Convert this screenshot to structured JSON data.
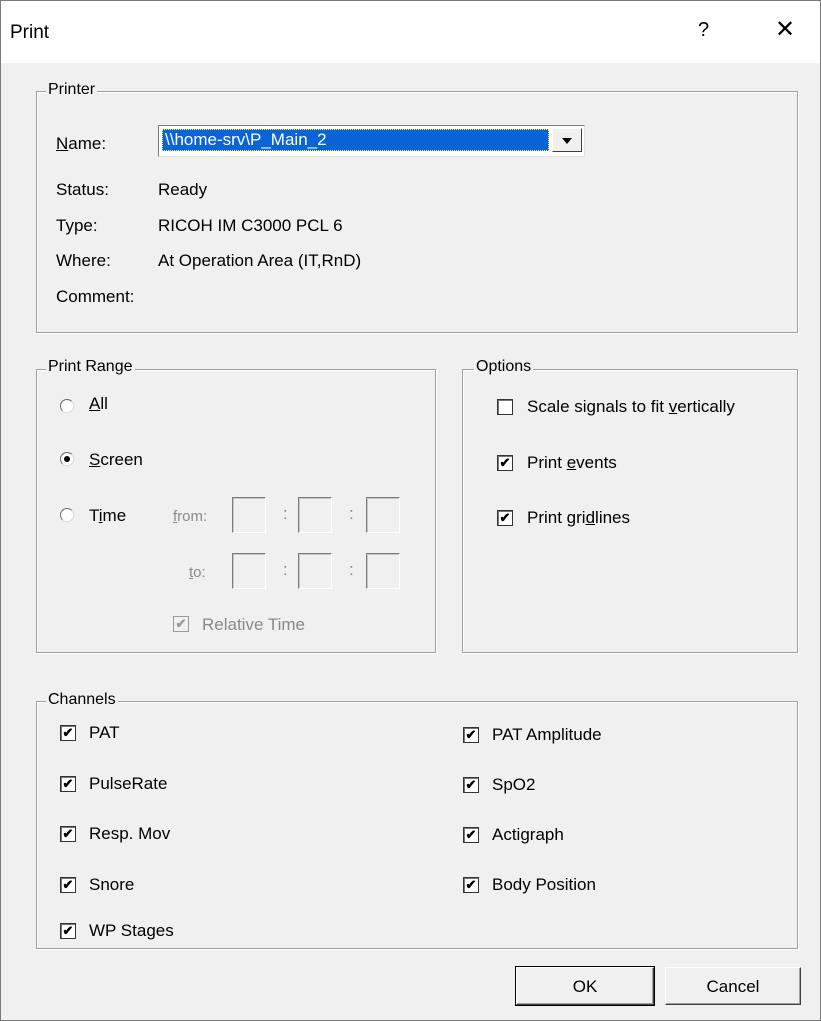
{
  "window": {
    "title": "Print",
    "help_label": "?",
    "close_label": "✕"
  },
  "printer": {
    "group_label": "Printer",
    "name_label": "ame:",
    "name_mnemonic": "N",
    "name_value": "\\\\home-srv\\P_Main_2",
    "status_label": "Status:",
    "status_value": "Ready",
    "type_label": "Type:",
    "type_value": "RICOH IM C3000 PCL 6",
    "where_label": "Where:",
    "where_value": "At Operation Area (IT,RnD)",
    "comment_label": "Comment:",
    "comment_value": ""
  },
  "print_range": {
    "group_label": "Print Range",
    "all": {
      "mnemonic": "A",
      "rest": "ll",
      "selected": false
    },
    "screen": {
      "mnemonic": "S",
      "rest": "creen",
      "selected": true
    },
    "time": {
      "pre": "T",
      "mnemonic": "i",
      "rest": "me",
      "selected": false
    },
    "from_mnemonic": "f",
    "from_rest": "rom:",
    "to_mnemonic": "t",
    "to_rest": "o:",
    "separator": ":",
    "relative_time_label": "Relative Time",
    "relative_time_checked": true,
    "relative_time_check": "✔"
  },
  "options": {
    "group_label": "Options",
    "scale": {
      "pre": "Scale signals to fit ",
      "mnemonic": "v",
      "rest": "ertically",
      "checked": false,
      "mark": ""
    },
    "events": {
      "pre": "Print ",
      "mnemonic": "e",
      "rest": "vents",
      "checked": true,
      "mark": "✔"
    },
    "gridlines": {
      "pre": "Print gri",
      "mnemonic": "d",
      "rest": "lines",
      "checked": true,
      "mark": "✔"
    }
  },
  "channels": {
    "group_label": "Channels",
    "left": [
      {
        "label": "PAT",
        "checked": true,
        "mark": "✔"
      },
      {
        "label": "PulseRate",
        "checked": true,
        "mark": "✔"
      },
      {
        "label": "Resp. Mov",
        "checked": true,
        "mark": "✔"
      },
      {
        "label": "Snore",
        "checked": true,
        "mark": "✔"
      },
      {
        "label": "WP Stages",
        "checked": true,
        "mark": "✔"
      }
    ],
    "right": [
      {
        "label": "PAT Amplitude",
        "checked": true,
        "mark": "✔"
      },
      {
        "label": "SpO2",
        "checked": true,
        "mark": "✔"
      },
      {
        "label": "Actigraph",
        "checked": true,
        "mark": "✔"
      },
      {
        "label": "Body Position",
        "checked": true,
        "mark": "✔"
      }
    ]
  },
  "buttons": {
    "ok_label": "OK",
    "cancel_label": "Cancel"
  }
}
